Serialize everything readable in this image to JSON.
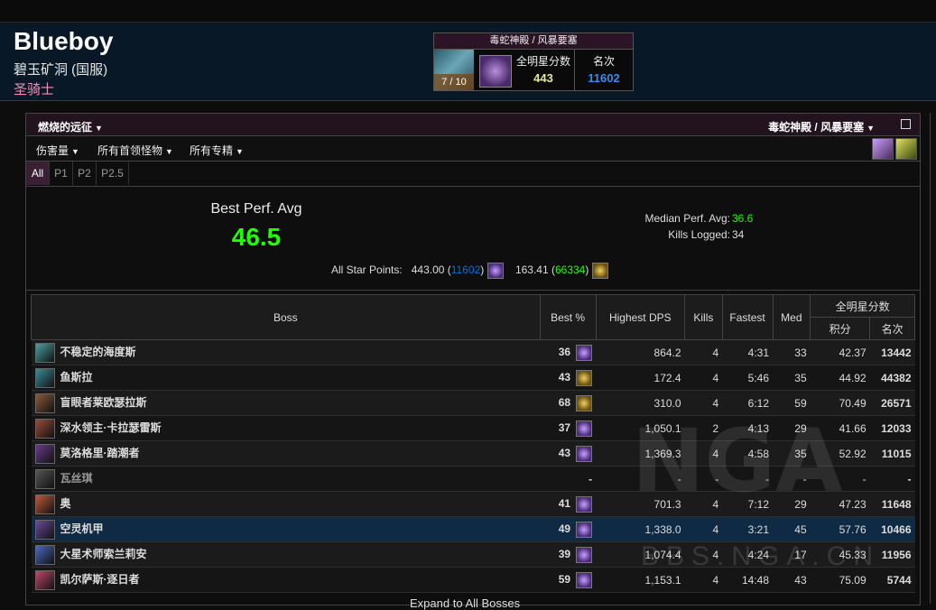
{
  "character": {
    "name": "Blueboy",
    "server": "碧玉矿洞 (国服)",
    "class": "圣骑士",
    "class_color": "#f58cba"
  },
  "zone_box": {
    "title": "毒蛇神殿 / 风暴要塞",
    "progress": "7 / 10",
    "points_label": "全明星分数",
    "points": "443",
    "rank_label": "名次",
    "rank": "11602"
  },
  "filters": {
    "expansion": "燃烧的远征",
    "zone": "毒蛇神殿 / 风暴要塞",
    "metric": "伤害量",
    "bosses": "所有首领怪物",
    "specs": "所有专精"
  },
  "tabs": [
    "All",
    "P1",
    "P2",
    "P2.5"
  ],
  "summary": {
    "best_label": "Best Perf. Avg",
    "best_value": "46.5",
    "median_label": "Median Perf. Avg:",
    "median_value": "36.6",
    "kills_label": "Kills Logged:",
    "kills_value": "34",
    "asp_label": "All Star Points:",
    "asp1": "443.00",
    "asp1_rank": "11602",
    "asp2": "163.41",
    "asp2_rank": "66334"
  },
  "table": {
    "headers": {
      "boss": "Boss",
      "best": "Best %",
      "dps": "Highest DPS",
      "kills": "Kills",
      "fastest": "Fastest",
      "med": "Med",
      "allstar": "全明星分数",
      "points": "积分",
      "rank": "名次"
    },
    "rows": [
      {
        "boss": "不稳定的海度斯",
        "best": "36",
        "dps": "864.2",
        "kills": "4",
        "fastest": "4:31",
        "med": "33",
        "points": "42.37",
        "rank": "13442"
      },
      {
        "boss": "鱼斯拉",
        "best": "43",
        "dps": "172.4",
        "kills": "4",
        "fastest": "5:46",
        "med": "35",
        "points": "44.92",
        "rank": "44382"
      },
      {
        "boss": "盲眼者莱欧瑟拉斯",
        "best": "68",
        "dps": "310.0",
        "kills": "4",
        "fastest": "6:12",
        "med": "59",
        "points": "70.49",
        "rank": "26571"
      },
      {
        "boss": "深水领主·卡拉瑟雷斯",
        "best": "37",
        "dps": "1,050.1",
        "kills": "2",
        "fastest": "4:13",
        "med": "29",
        "points": "41.66",
        "rank": "12033"
      },
      {
        "boss": "莫洛格里·踏潮者",
        "best": "43",
        "dps": "1,369.3",
        "kills": "4",
        "fastest": "4:58",
        "med": "35",
        "points": "52.92",
        "rank": "11015"
      },
      {
        "boss": "瓦丝琪",
        "best": "-",
        "dps": "-",
        "kills": "-",
        "fastest": "-",
        "med": "-",
        "points": "-",
        "rank": "-"
      },
      {
        "boss": "奥",
        "best": "41",
        "dps": "701.3",
        "kills": "4",
        "fastest": "7:12",
        "med": "29",
        "points": "47.23",
        "rank": "11648"
      },
      {
        "boss": "空灵机甲",
        "best": "49",
        "dps": "1,338.0",
        "kills": "4",
        "fastest": "3:21",
        "med": "45",
        "points": "57.76",
        "rank": "10466"
      },
      {
        "boss": "大星术师索兰莉安",
        "best": "39",
        "dps": "1,074.4",
        "kills": "4",
        "fastest": "4:24",
        "med": "17",
        "points": "45.33",
        "rank": "11956"
      },
      {
        "boss": "凯尔萨斯·逐日者",
        "best": "59",
        "dps": "1,153.1",
        "kills": "4",
        "fastest": "14:48",
        "med": "43",
        "points": "75.09",
        "rank": "5744"
      }
    ]
  },
  "watermark": {
    "logo": "NGA",
    "site": "BBS.NGA.CN"
  },
  "footer_peek": "Expand to All Bosses"
}
